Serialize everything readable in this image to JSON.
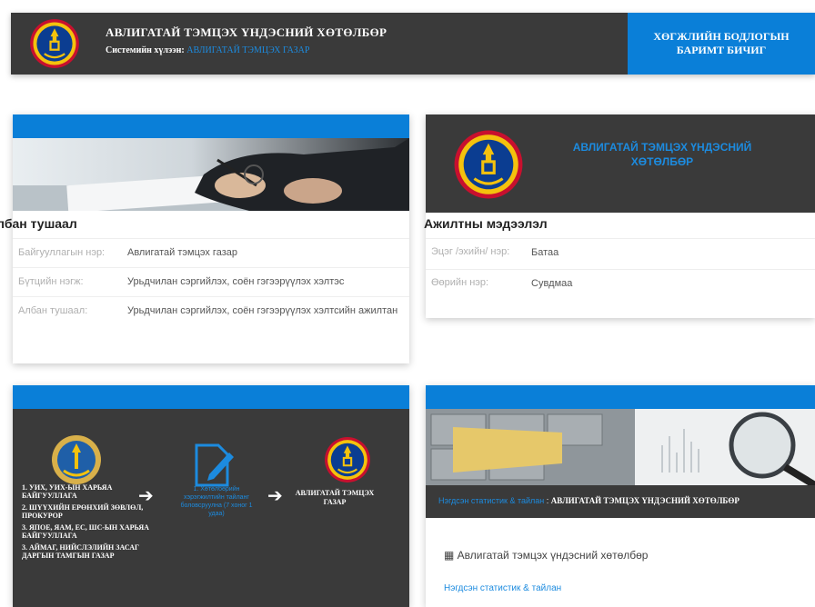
{
  "header": {
    "title": "АВЛИГАТАЙ ТЭМЦЭХ ҮНДЭСНИЙ ХӨТӨЛБӨР",
    "sub_label": "Системийн хүлээн:",
    "sub_link": "АВЛИГАТАЙ ТЭМЦЭХ ГАЗАР",
    "button_label": "ХӨГЖЛИЙН БОДЛОГЫН БАРИМТ БИЧИГ"
  },
  "card_office": {
    "section_title": "Албан тушаал",
    "rows": [
      {
        "key": "Байгууллагын нэр:",
        "value": "Авлигатай тэмцэх газар"
      },
      {
        "key": "Бүтцийн нэгж:",
        "value": "Урьдчилан сэргийлэх, соён гэгээрүүлэх хэлтэс"
      },
      {
        "key": "Албан тушаал:",
        "value": "Урьдчилан сэргийлэх, соён гэгээрүүлэх хэлтсийн ажилтан"
      }
    ]
  },
  "card_employee": {
    "org_name": "АВЛИГАТАЙ ТЭМЦЭХ ҮНДЭСНИЙ ХӨТӨЛБӨР",
    "section_title": "Ажилтны мэдээлэл",
    "rows": [
      {
        "key": "Эцэг /эхийн/ нэр:",
        "value": "Батаа"
      },
      {
        "key": "Өөрийн нэр:",
        "value": "Сувдмаа"
      }
    ]
  },
  "card_flow": {
    "left_items": [
      "1. УИХ, УИХ-ЫН ХАРЬЯА БАЙГУУЛЛАГА",
      "2. ШҮҮХИЙН ЕРӨНХИЙ ЗӨВЛӨЛ, ПРОКУРОР",
      "3. ЯПОЕ, ЯАМ, ЕС, ШС-ЫН ХАРЬЯА БАЙГУУЛЛАГА",
      "3. АЙМАГ, НИЙСЛЭЛИЙН ЗАСАГ ДАРГЫН ТАМГЫН ГАЗАР"
    ],
    "middle_text": "1. Хөтөлбөрийн хэрэгжилтийн тайланг боловсруулна (7 хоног 1 удаа)",
    "right_text": "АВЛИГАТАЙ ТЭМЦЭХ ГАЗАР"
  },
  "card_report": {
    "breadcrumb_link": "Нэгдсэн статистик & тайлан",
    "breadcrumb_sep": ":",
    "breadcrumb_current": "АВЛИГАТАЙ ТЭМЦЭХ ҮНДЭСНИЙ ХӨТӨЛБӨР",
    "heading": "Авлигатай тэмцэх үндэсний хөтөлбөр",
    "link": "Нэгдсэн статистик & тайлан"
  },
  "colors": {
    "accent": "#0a7fd8",
    "dark": "#3a3a3a",
    "link": "#1c8bdf"
  }
}
